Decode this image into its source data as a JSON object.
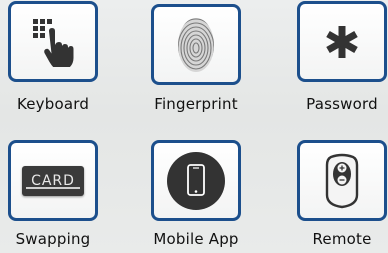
{
  "colors": {
    "tile_border": "#1c4f8c",
    "icon_dark": "#333333",
    "background": "#e6e8e7"
  },
  "methods": [
    {
      "label": "Keyboard",
      "icon": "keypad-hand-icon"
    },
    {
      "label": "Fingerprint",
      "icon": "fingerprint-icon"
    },
    {
      "label": "Password",
      "icon": "asterisk-icon"
    },
    {
      "label": "Swapping",
      "icon": "card-icon",
      "icon_text": "CARD"
    },
    {
      "label": "Mobile App",
      "icon": "smartphone-icon"
    },
    {
      "label": "Remote",
      "icon": "remote-fob-icon"
    }
  ]
}
